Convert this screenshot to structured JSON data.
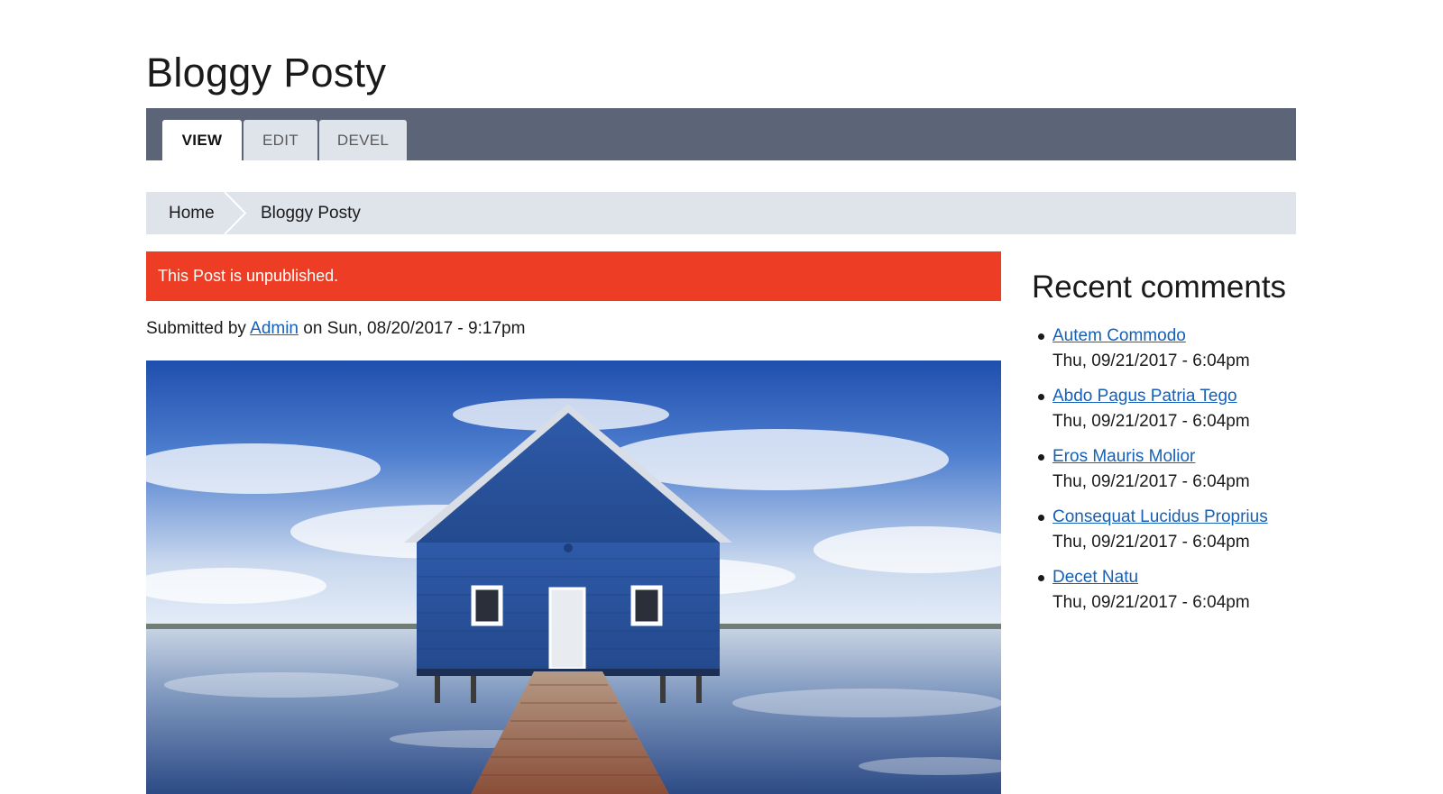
{
  "page": {
    "title": "Bloggy Posty"
  },
  "tabs": [
    {
      "label": "View",
      "active": true
    },
    {
      "label": "Edit",
      "active": false
    },
    {
      "label": "Devel",
      "active": false
    }
  ],
  "breadcrumb": {
    "home": "Home",
    "current": "Bloggy Posty"
  },
  "alert": {
    "message": "This Post is unpublished.",
    "color": "#ee3d25"
  },
  "submitted": {
    "prefix": "Submitted by",
    "author": "Admin",
    "suffix": "on Sun, 08/20/2017 - 9:17pm"
  },
  "image": {
    "subject": "blue-boathouse-on-lake"
  },
  "sidebar": {
    "title": "Recent comments",
    "comments": [
      {
        "title": "Autem Commodo",
        "date": "Thu, 09/21/2017 - 6:04pm"
      },
      {
        "title": "Abdo Pagus Patria Tego",
        "date": "Thu, 09/21/2017 - 6:04pm"
      },
      {
        "title": "Eros Mauris Molior",
        "date": "Thu, 09/21/2017 - 6:04pm"
      },
      {
        "title": "Consequat Lucidus Proprius",
        "date": "Thu, 09/21/2017 - 6:04pm"
      },
      {
        "title": "Decet Natu",
        "date": "Thu, 09/21/2017 - 6:04pm"
      }
    ]
  },
  "colors": {
    "tab_bar": "#5b6577",
    "breadcrumb_bg": "#dfe3ea",
    "link": "#1660b8"
  }
}
